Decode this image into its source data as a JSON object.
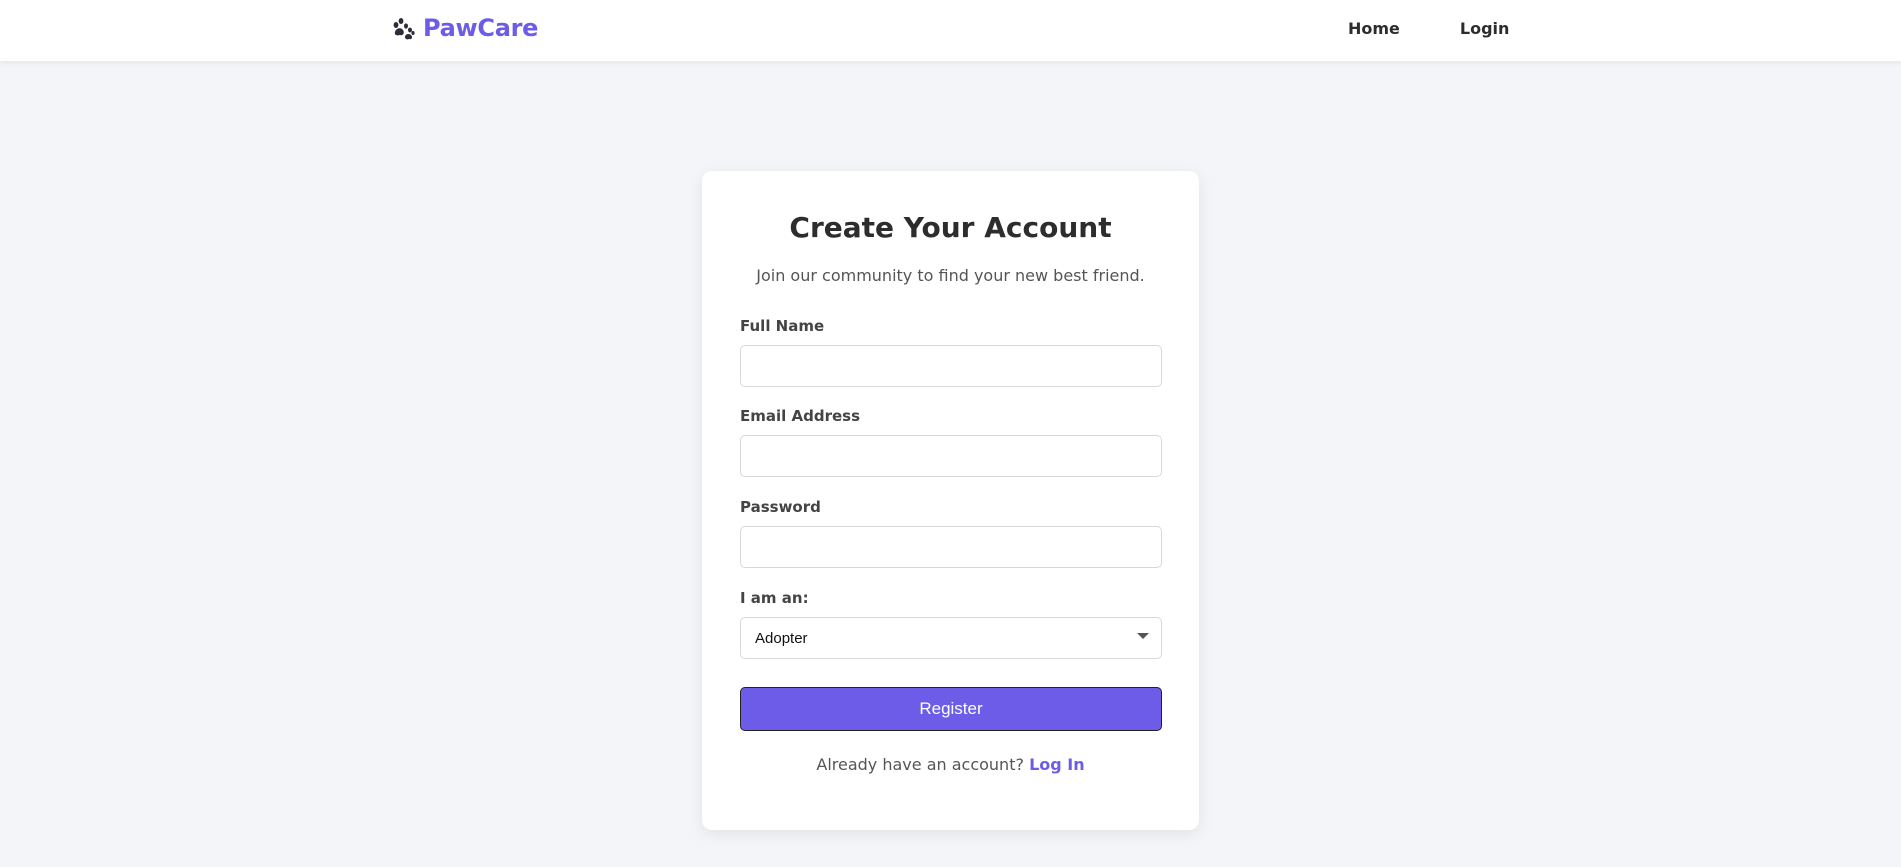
{
  "brand": {
    "name": "PawCare",
    "icon": "paw-icon",
    "color": "#6c5ce7"
  },
  "nav": {
    "home_label": "Home",
    "login_label": "Login"
  },
  "card": {
    "title": "Create Your Account",
    "subtitle": "Join our community to find your new best friend.",
    "fields": {
      "full_name": {
        "label": "Full Name",
        "value": "",
        "placeholder": ""
      },
      "email": {
        "label": "Email Address",
        "value": "",
        "placeholder": ""
      },
      "password": {
        "label": "Password",
        "value": "",
        "placeholder": ""
      },
      "role": {
        "label": "I am an:",
        "selected": "Adopter"
      }
    },
    "register_label": "Register",
    "footer_text": "Already have an account?",
    "footer_link": "Log In"
  },
  "colors": {
    "accent": "#6c5ce7",
    "background": "#f4f5f8"
  }
}
